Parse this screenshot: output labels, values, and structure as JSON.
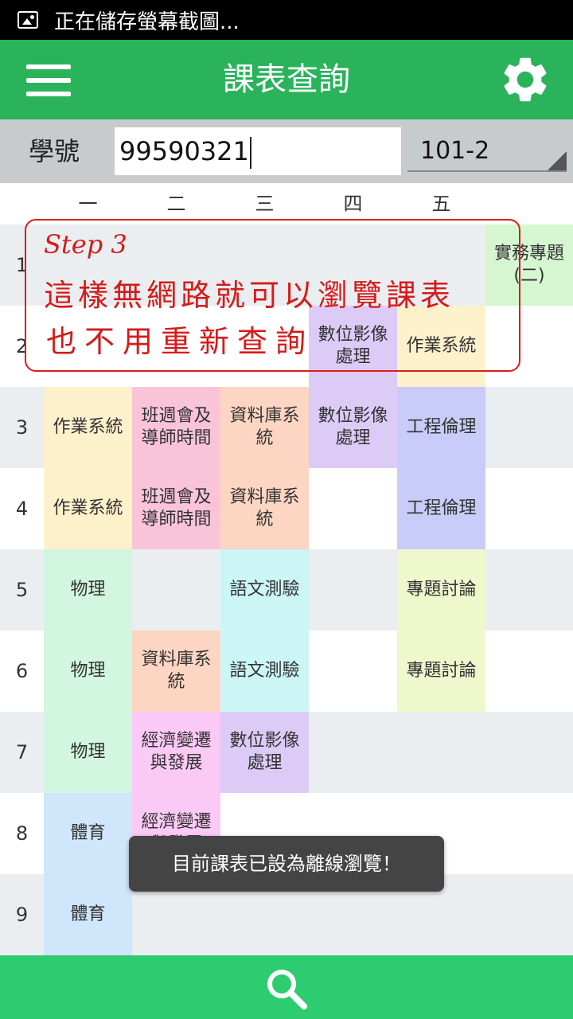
{
  "status_bar": {
    "icon": "image-icon",
    "text": "正在儲存螢幕截圖..."
  },
  "app_bar": {
    "title": "課表查詢",
    "menu_icon": "hamburger-menu-icon",
    "settings_icon": "gear-icon"
  },
  "query": {
    "student_id_label": "學號",
    "student_id_value": "99590321",
    "semester_value": "101-2"
  },
  "timetable": {
    "days": [
      "一",
      "二",
      "三",
      "四",
      "五"
    ],
    "periods": [
      "1",
      "2",
      "3",
      "4",
      "5",
      "6",
      "7",
      "8",
      "9"
    ],
    "extra_column_course": "實務專題(二)",
    "courses": {
      "p2_thu": "數位影像處理",
      "p2_fri": "作業系統",
      "p3_mon": "作業系統",
      "p3_tue": "班週會及導師時間",
      "p3_wed": "資料庫系統",
      "p3_thu": "數位影像處理",
      "p3_fri": "工程倫理",
      "p4_mon": "作業系統",
      "p4_tue": "班週會及導師時間",
      "p4_wed": "資料庫系統",
      "p4_fri": "工程倫理",
      "p5_mon": "物理",
      "p5_wed": "語文測驗",
      "p5_fri": "專題討論",
      "p6_mon": "物理",
      "p6_tue": "資料庫系統",
      "p6_wed": "語文測驗",
      "p6_fri": "專題討論",
      "p7_mon": "物理",
      "p7_tue": "經濟變遷與發展",
      "p7_wed": "數位影像處理",
      "p8_mon": "體育",
      "p8_tue": "經濟變遷與發展",
      "p9_mon": "體育"
    },
    "colors": {
      "os": "#fdf1cc",
      "meeting": "#f9c4d8",
      "database": "#fdd5c3",
      "image": "#dccbf7",
      "ethics": "#c9ccf9",
      "physics": "#d2f6e0",
      "language": "#ccf6f6",
      "seminar": "#eff7cd",
      "economics": "#fbc9f6",
      "pe": "#cfe6fb",
      "project": "#d6f6d2"
    }
  },
  "annotation": {
    "step": "Step 3",
    "line1": "這樣無網路就可以瀏覽課表",
    "line2": "也不用重新查詢"
  },
  "toast": {
    "text": "目前課表已設為離線瀏覽！"
  },
  "bottom_bar": {
    "search_icon": "search-icon"
  }
}
